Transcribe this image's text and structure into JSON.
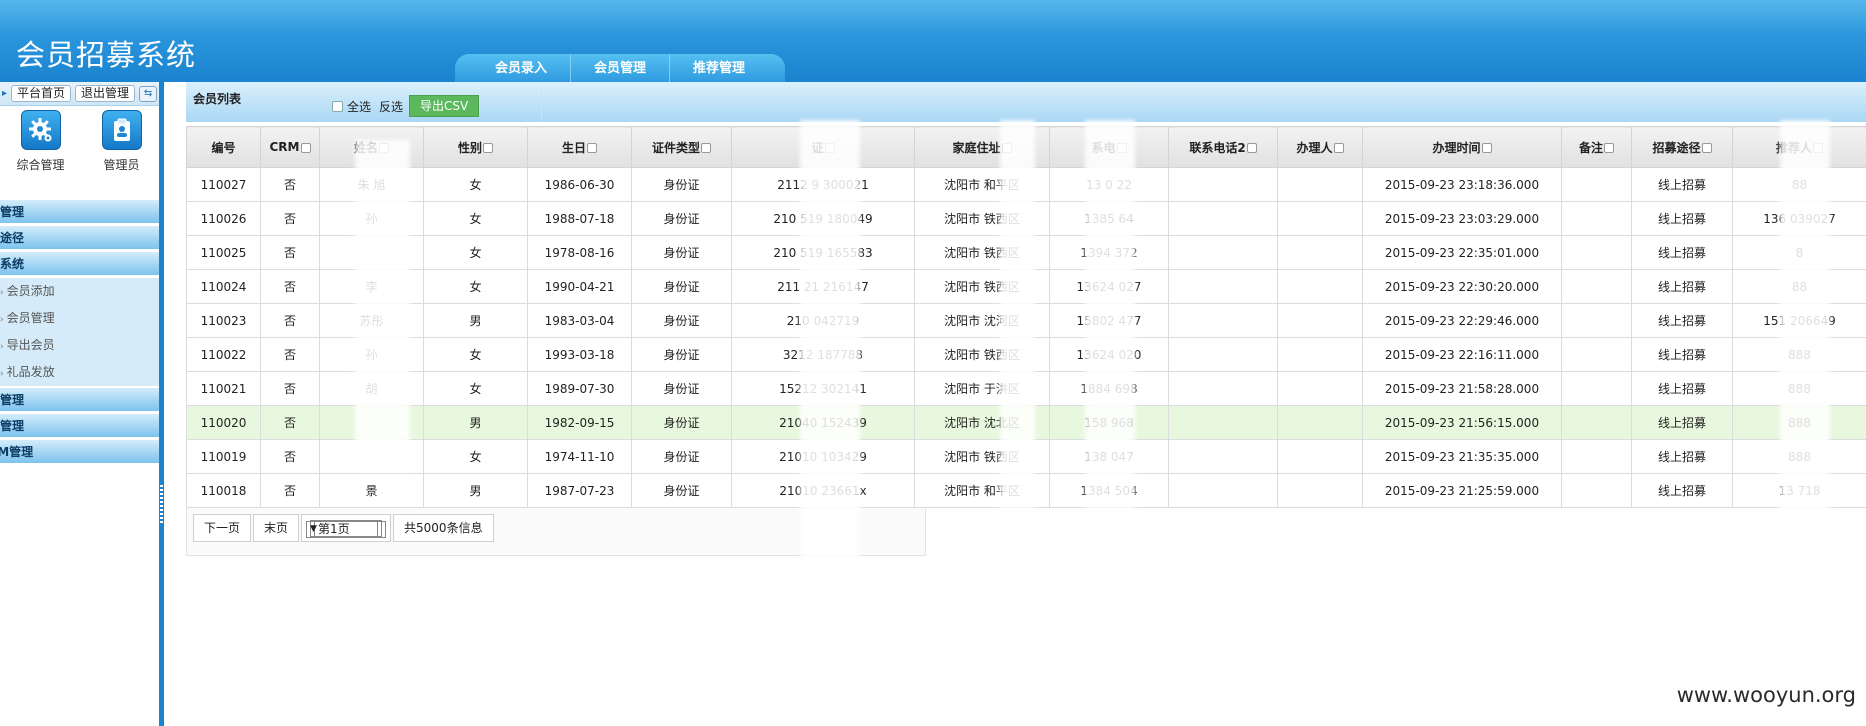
{
  "app": {
    "title": "会员招募系统"
  },
  "nav": {
    "tabs": [
      "会员录入",
      "会员管理",
      "推荐管理"
    ]
  },
  "sidebar": {
    "top_buttons": [
      "平台首页",
      "退出管理"
    ],
    "quick": [
      {
        "label": "综合管理",
        "icon": "gear-icon"
      },
      {
        "label": "管理员",
        "icon": "clipboard-icon"
      }
    ],
    "sections": [
      {
        "label": "区管理",
        "items": []
      },
      {
        "label": "募途径",
        "items": []
      },
      {
        "label": "员系统",
        "items": [
          "会员添加",
          "会员管理",
          "导出会员",
          "礼品发放"
        ]
      },
      {
        "label": "荐管理",
        "items": []
      },
      {
        "label": "品管理",
        "items": []
      },
      {
        "label": "RM管理",
        "items": []
      }
    ]
  },
  "list": {
    "title": "会员列表",
    "select_all": "全选",
    "invert": "反选",
    "export_csv": "导出CSV"
  },
  "table": {
    "columns": [
      "编号",
      "CRM",
      "姓名",
      "性别",
      "生日",
      "证件类型",
      "证",
      "家庭住址",
      "系电",
      "联系电话2",
      "办理人",
      "办理时间",
      "备注",
      "招募途径",
      "推荐人"
    ],
    "rows": [
      [
        "110027",
        "否",
        "朱  旭",
        "女",
        "1986-06-30",
        "身份证",
        "2112    9    300021",
        "沈阳市 和平区",
        "13    0    22",
        "",
        "",
        "2015-09-23 23:18:36.000",
        "",
        "线上招募",
        "  88"
      ],
      [
        "110026",
        "否",
        "孙  ",
        "女",
        "1988-07-18",
        "身份证",
        "210  519    180049",
        "沈阳市 铁西区",
        "1385    64",
        "",
        "",
        "2015-09-23 23:03:29.000",
        "",
        "线上招募",
        "136  039027"
      ],
      [
        "110025",
        "否",
        "  ",
        "女",
        "1978-08-16",
        "身份证",
        "210  519    165583",
        "沈阳市 铁西区",
        "1394    372",
        "",
        "",
        "2015-09-23 22:35:01.000",
        "",
        "线上招募",
        "  8"
      ],
      [
        "110024",
        "否",
        "李  ",
        "女",
        "1990-04-21",
        "身份证",
        "211  21    216147",
        "沈阳市 铁西区",
        "13624    027",
        "",
        "",
        "2015-09-23 22:30:20.000",
        "",
        "线上招募",
        "  88"
      ],
      [
        "110023",
        "否",
        "苏彤  ",
        "男",
        "1983-03-04",
        "身份证",
        "210      042719",
        "沈阳市 沈河区",
        "15802    477",
        "",
        "",
        "2015-09-23 22:29:46.000",
        "",
        "线上招募",
        "151  206649"
      ],
      [
        "110022",
        "否",
        "孙  ",
        "女",
        "1993-03-18",
        "身份证",
        "3212      187788",
        "沈阳市 铁西区",
        "13624    020",
        "",
        "",
        "2015-09-23 22:16:11.000",
        "",
        "线上招募",
        "  888"
      ],
      [
        "110021",
        "否",
        "胡  ",
        "女",
        "1989-07-30",
        "身份证",
        "15212      302141",
        "沈阳市 于洪区",
        "1884    698",
        "",
        "",
        "2015-09-23 21:58:28.000",
        "",
        "线上招募",
        "  888"
      ],
      [
        "110020",
        "否",
        "  ",
        "男",
        "1982-09-15",
        "身份证",
        "21040      152439",
        "沈阳市 沈北区",
        "158    968",
        "",
        "",
        "2015-09-23 21:56:15.000",
        "",
        "线上招募",
        "  888"
      ],
      [
        "110019",
        "否",
        "  ",
        "女",
        "1974-11-10",
        "身份证",
        "21010      103429",
        "沈阳市 铁西区",
        "138    047",
        "",
        "",
        "2015-09-23 21:35:35.000",
        "",
        "线上招募",
        "  888"
      ],
      [
        "110018",
        "否",
        "景  ",
        "男",
        "1987-07-23",
        "身份证",
        "21010      23661x",
        "沈阳市 和平区",
        "1384    504",
        "",
        "",
        "2015-09-23 21:25:59.000",
        "",
        "线上招募",
        "13    718"
      ]
    ],
    "highlight_row": 7
  },
  "pager": {
    "next": "下一页",
    "last": "末页",
    "page_select": "第1页",
    "total": "共5000条信息"
  },
  "watermark": "www.wooyun.org"
}
